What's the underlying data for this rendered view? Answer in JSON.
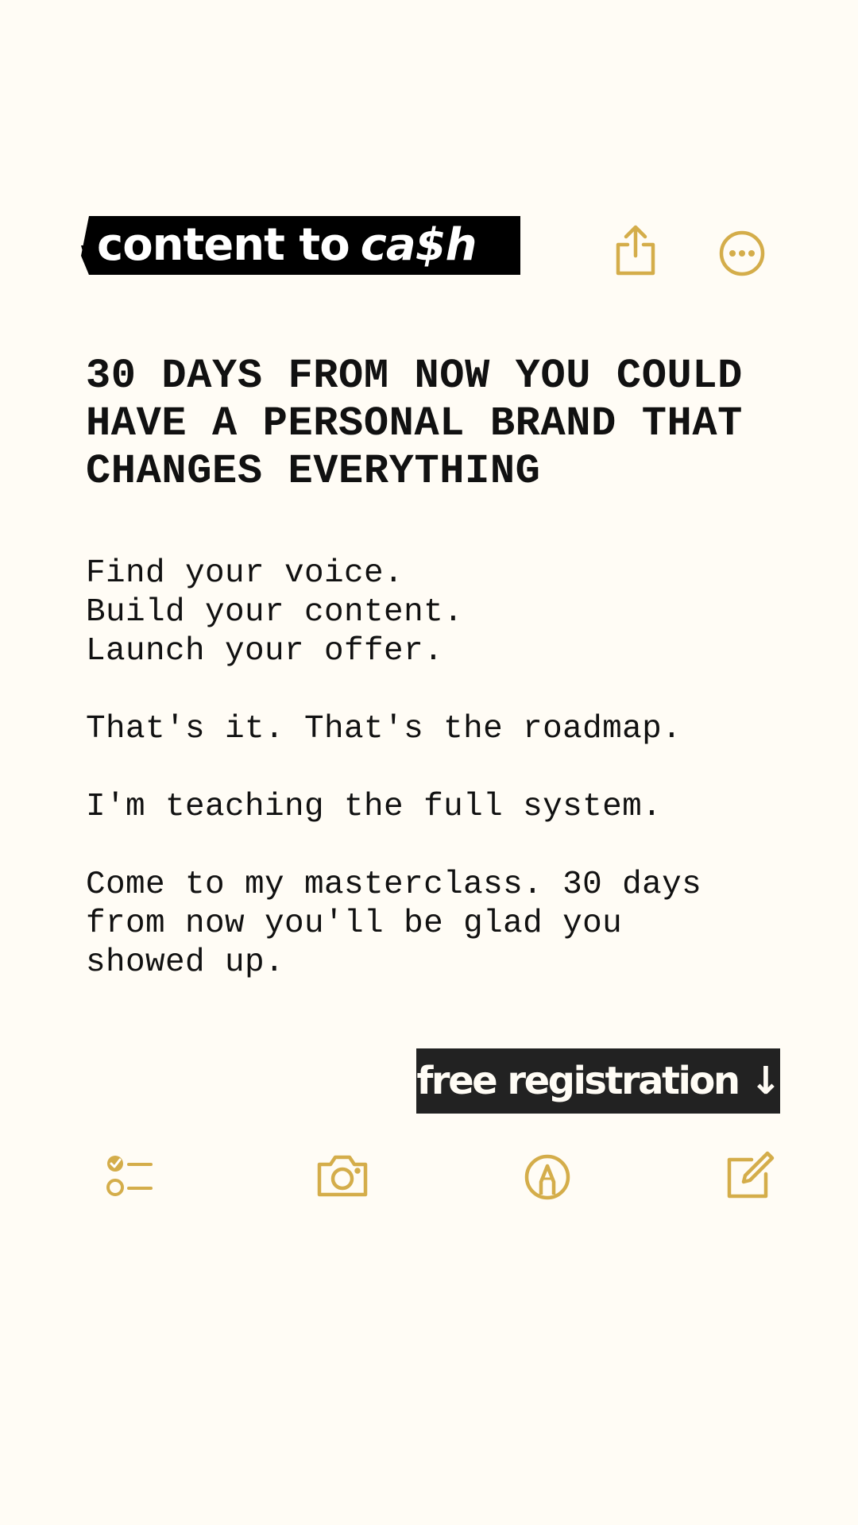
{
  "logo": {
    "part1": "content to",
    "part2": "ca$h"
  },
  "headline": "30 DAYS FROM NOW YOU COULD\nHAVE A PERSONAL BRAND THAT\nCHANGES EVERYTHING",
  "body": {
    "p1": "Find your voice.\nBuild your content.\nLaunch your offer.",
    "p2": "That's it. That's the roadmap.",
    "p3": "I'm teaching the full system.",
    "p4": "Come to my masterclass. 30 days\nfrom now you'll be glad you\nshowed up."
  },
  "cta": {
    "label": "free registration ↓"
  },
  "icons": {
    "top": [
      "share-icon",
      "more-icon"
    ],
    "toolbar": [
      "checklist-icon",
      "camera-icon",
      "markup-icon",
      "compose-icon"
    ]
  },
  "colors": {
    "accent": "#d4ad4a",
    "background": "#fffcf5",
    "cta_bg": "#222222",
    "logo_bg": "#000000"
  }
}
